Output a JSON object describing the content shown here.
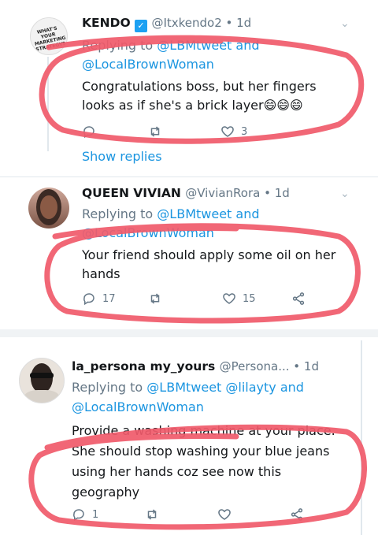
{
  "tweets": [
    {
      "name": "KENDO",
      "handle": "@Itxkendo2 • 1d",
      "replying_prefix": "Replying to",
      "replying_links": [
        "@LBMtweet and",
        "@LocalBrownWoman"
      ],
      "text": "Congratulations boss, but her fingers looks as if she's a brick layer😄😄😄",
      "reply_count": "",
      "retweet_count": "",
      "like_count": "3",
      "avatar_text": "WHAT'S YOUR MARKETING STRATEGY?"
    },
    {
      "name": "QUEEN VIVIAN",
      "handle": "@VivianRora • 1d",
      "replying_prefix": "Replying to",
      "replying_links": [
        "@LBMtweet and",
        "@LocalBrownWoman"
      ],
      "text": "Your friend should apply some oil on her hands",
      "reply_count": "17",
      "retweet_count": "",
      "like_count": "15"
    },
    {
      "name": "la_persona my_yours",
      "handle": "@Persona... • 1d",
      "replying_prefix": "Replying to",
      "replying_links": [
        "@LBMtweet",
        "@lilayty and",
        "@LocalBrownWoman"
      ],
      "text": "Provide a washing machine at your place. She should stop washing your blue jeans using her hands coz see now this geography",
      "reply_count": "1",
      "retweet_count": "",
      "like_count": ""
    }
  ],
  "show_replies": "Show replies",
  "colors": {
    "link": "#1b95e0",
    "muted": "#657786",
    "scribble": "#f05a6a",
    "verified": "#1da1f2"
  }
}
